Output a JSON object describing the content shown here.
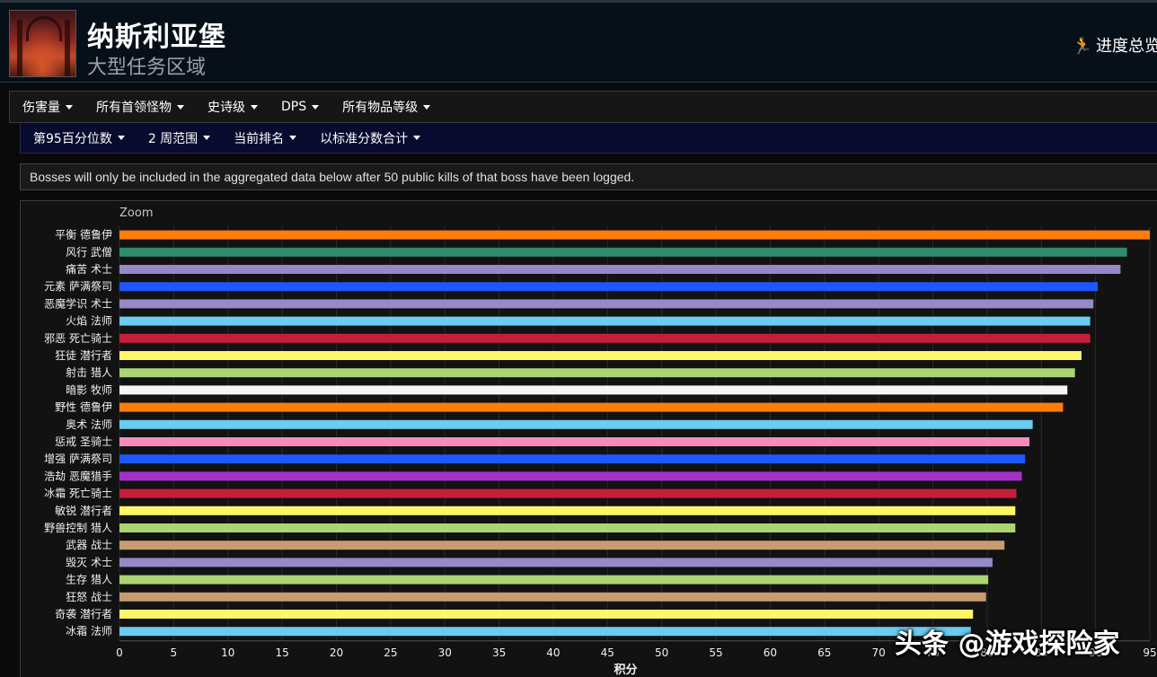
{
  "zone": {
    "title": "纳斯利亚堡",
    "subtitle": "大型任务区域",
    "progress_link": "进度总览",
    "progress_icon": "running-figure-icon"
  },
  "menu": {
    "items": [
      "伤害量",
      "所有首领怪物",
      "史诗级",
      "DPS",
      "所有物品等级"
    ]
  },
  "submenu": {
    "items": [
      "第95百分位数",
      "2 周范围",
      "当前排名",
      "以标准分数合计"
    ]
  },
  "notice": "Bosses will only be included in the aggregated data below after 50 public kills of that boss have been logged.",
  "watermark": "头条 @游戏探险家",
  "chart_data": {
    "type": "bar",
    "orientation": "horizontal",
    "zoom_label": "Zoom",
    "xlabel": "积分",
    "xlim": [
      0,
      95
    ],
    "xticks": [
      0,
      5,
      10,
      15,
      20,
      25,
      30,
      35,
      40,
      45,
      50,
      55,
      60,
      65,
      70,
      75,
      80,
      85,
      90,
      95
    ],
    "grid": true,
    "categories": [
      "平衡 德鲁伊",
      "风行 武僧",
      "痛苦 术士",
      "元素 萨满祭司",
      "恶魔学识 术士",
      "火焰 法师",
      "邪恶 死亡骑士",
      "狂徒 潜行者",
      "射击 猎人",
      "暗影 牧师",
      "野性 德鲁伊",
      "奥术 法师",
      "惩戒 圣骑士",
      "增强 萨满祭司",
      "浩劫 恶魔猎手",
      "冰霜 死亡骑士",
      "敏锐 潜行者",
      "野兽控制 猎人",
      "武器 战士",
      "毁灭 术士",
      "生存 猎人",
      "狂怒 战士",
      "奇袭 潜行者",
      "冰霜 法师"
    ],
    "values": [
      95.0,
      92.9,
      92.3,
      90.2,
      89.8,
      89.5,
      89.5,
      88.7,
      88.1,
      87.4,
      87.0,
      84.2,
      83.9,
      83.5,
      83.2,
      82.7,
      82.6,
      82.6,
      81.6,
      80.5,
      80.1,
      79.9,
      78.7,
      78.5
    ],
    "colors": [
      "#ff7d0a",
      "#2f8d6e",
      "#9788c8",
      "#1e56ff",
      "#9788c8",
      "#69ccf0",
      "#c41f3b",
      "#fff569",
      "#abd473",
      "#f5f5f5",
      "#ff7d0a",
      "#69ccf0",
      "#f58cba",
      "#1e56ff",
      "#a330c9",
      "#c41f3b",
      "#fff569",
      "#abd473",
      "#c79c6e",
      "#9788c8",
      "#abd473",
      "#c79c6e",
      "#fff569",
      "#69ccf0"
    ]
  }
}
